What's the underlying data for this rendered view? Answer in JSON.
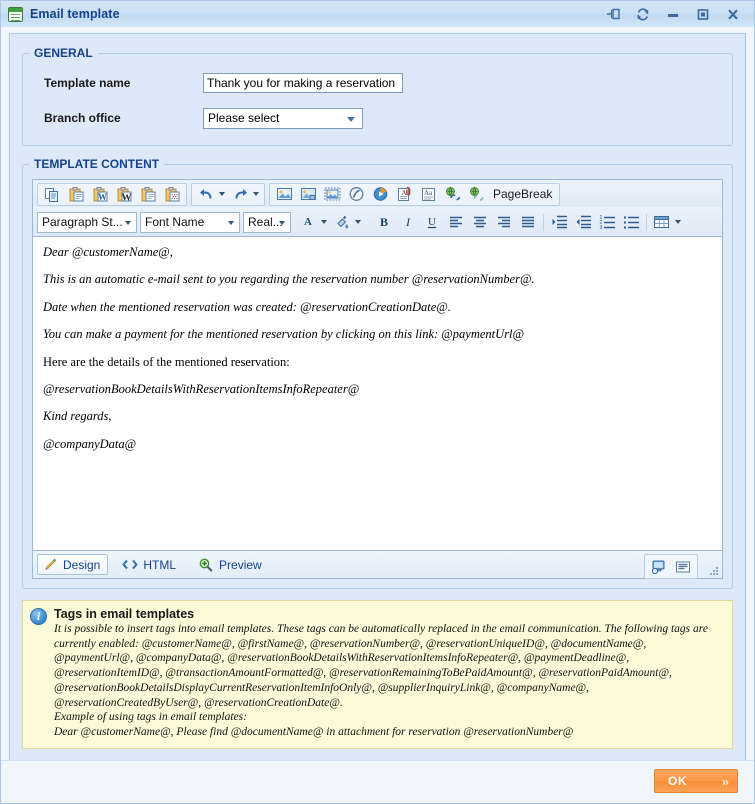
{
  "window": {
    "title": "Email template",
    "icon": "email-template-icon",
    "buttons": [
      {
        "name": "pin-window-button",
        "label": "Pin"
      },
      {
        "name": "refresh-button",
        "label": "Refresh"
      },
      {
        "name": "minimize-button",
        "label": "Minimize"
      },
      {
        "name": "maximize-button",
        "label": "Maximize"
      },
      {
        "name": "close-button",
        "label": "Close"
      }
    ]
  },
  "general": {
    "legend": "GENERAL",
    "template_name_label": "Template name",
    "template_name_value": "Thank you for making a reservation",
    "branch_office_label": "Branch office",
    "branch_office_value": "Please select"
  },
  "template_content": {
    "legend": "TEMPLATE CONTENT",
    "toolbar_row1": [
      {
        "name": "copy-icon",
        "label": "Copy"
      },
      {
        "name": "paste-icon",
        "label": "Paste"
      },
      {
        "name": "paste-from-word-icon",
        "label": "Paste from Word"
      },
      {
        "name": "paste-from-word-clean-icon",
        "label": "Paste from Word, strip font"
      },
      {
        "name": "paste-plain-text-icon",
        "label": "Paste as plain text"
      },
      {
        "name": "paste-special-icon",
        "label": "Paste special"
      },
      {
        "name": "undo-icon",
        "label": "Undo"
      },
      {
        "name": "undo-dropdown-arrow",
        "label": "Undo history"
      },
      {
        "name": "redo-icon",
        "label": "Redo"
      },
      {
        "name": "redo-dropdown-arrow",
        "label": "Redo history"
      },
      {
        "name": "insert-image-icon",
        "label": "Insert image"
      },
      {
        "name": "image-manager-icon",
        "label": "Image manager"
      },
      {
        "name": "image-map-editor-icon",
        "label": "Image map editor"
      },
      {
        "name": "flash-manager-icon",
        "label": "Flash manager"
      },
      {
        "name": "media-manager-icon",
        "label": "Media manager"
      },
      {
        "name": "document-manager-icon",
        "label": "Document manager"
      },
      {
        "name": "spellcheck-icon",
        "label": "Spellcheck"
      },
      {
        "name": "insert-link-icon",
        "label": "Hyperlink manager"
      },
      {
        "name": "remove-link-icon",
        "label": "Remove link"
      },
      {
        "name": "pagebreak-button",
        "label": "PageBreak"
      }
    ],
    "toolbar_row2": {
      "paragraph_style": "Paragraph St...",
      "font_name": "Font Name",
      "font_size": "Real...",
      "items": [
        {
          "name": "foreground-color-icon",
          "label": "A"
        },
        {
          "name": "foreground-color-dropdown-arrow",
          "label": "Foreground color"
        },
        {
          "name": "background-color-icon",
          "label": "Background color"
        },
        {
          "name": "background-color-dropdown-arrow",
          "label": "Background color options"
        },
        {
          "name": "bold-button",
          "label": "B"
        },
        {
          "name": "italic-button",
          "label": "I"
        },
        {
          "name": "underline-button",
          "label": "U"
        },
        {
          "name": "align-left-button",
          "label": "Align left"
        },
        {
          "name": "align-center-button",
          "label": "Align center"
        },
        {
          "name": "align-right-button",
          "label": "Align right"
        },
        {
          "name": "align-justify-button",
          "label": "Justify"
        },
        {
          "name": "indent-button",
          "label": "Indent"
        },
        {
          "name": "outdent-button",
          "label": "Outdent"
        },
        {
          "name": "numbered-list-button",
          "label": "Numbered list"
        },
        {
          "name": "bulleted-list-button",
          "label": "Bulleted list"
        },
        {
          "name": "insert-table-icon",
          "label": "Insert table"
        },
        {
          "name": "insert-table-dropdown-arrow",
          "label": "Table options"
        }
      ]
    },
    "editor_paragraphs": [
      {
        "text": "Dear @customerName@,",
        "style": "italic"
      },
      {
        "text": "This is an automatic e-mail sent to you regarding the reservation number @reservationNumber@.",
        "style": "italic"
      },
      {
        "text": "Date when the mentioned reservation was created: @reservationCreationDate@.",
        "style": "italic"
      },
      {
        "text": "You can make a payment for the mentioned reservation by clicking on this link: @paymentUrl@",
        "style": "italic"
      },
      {
        "text": "Here are the details of the mentioned reservation:",
        "style": "normal"
      },
      {
        "text": "@reservationBookDetailsWithReservationItemsInfoRepeater@",
        "style": "italic"
      },
      {
        "text": "Kind regards,",
        "style": "italic"
      },
      {
        "text": "@companyData@",
        "style": "italic"
      }
    ],
    "view_tabs": [
      {
        "name": "tab-design",
        "label": "Design",
        "icon": "pencil-icon",
        "active": true
      },
      {
        "name": "tab-html",
        "label": "HTML",
        "icon": "code-brackets-icon",
        "active": false
      },
      {
        "name": "tab-preview",
        "label": "Preview",
        "icon": "magnifier-plus-icon",
        "active": false
      }
    ],
    "foot_right_buttons": [
      {
        "name": "module-manager-icon",
        "label": "Module manager"
      },
      {
        "name": "statistics-icon",
        "label": "Statistics"
      }
    ]
  },
  "info": {
    "icon": "info-icon",
    "title": "Tags in email templates",
    "lines": [
      "It is possible to insert tags into email templates. These tags can be automatically replaced in the email communication. The following tags are currently enabled: @customerName@, @firstName@, @reservationNumber@, @reservationUniqueID@, @documentName@, @paymentUrl@, @companyData@, @reservationBookDetailsWithReservationItemsInfoRepeater@, @paymentDeadline@, @reservationItemID@, @transactionAmountFormatted@, @reservationRemainingToBePaidAmount@, @reservationPaidAmount@, @reservationBookDetailsDisplayCurrentReservationItemInfoOnly@, @supplierInquiryLink@, @companyName@, @reservationCreatedByUser@, @reservationCreationDate@.",
      "Example of using tags in email templates:",
      "Dear @customerName@, Please find @documentName@ in attachment for reservation @reservationNumber@"
    ]
  },
  "footer": {
    "ok_label": "OK",
    "ok_chevron": "»",
    "accent_color": "#f79640"
  }
}
